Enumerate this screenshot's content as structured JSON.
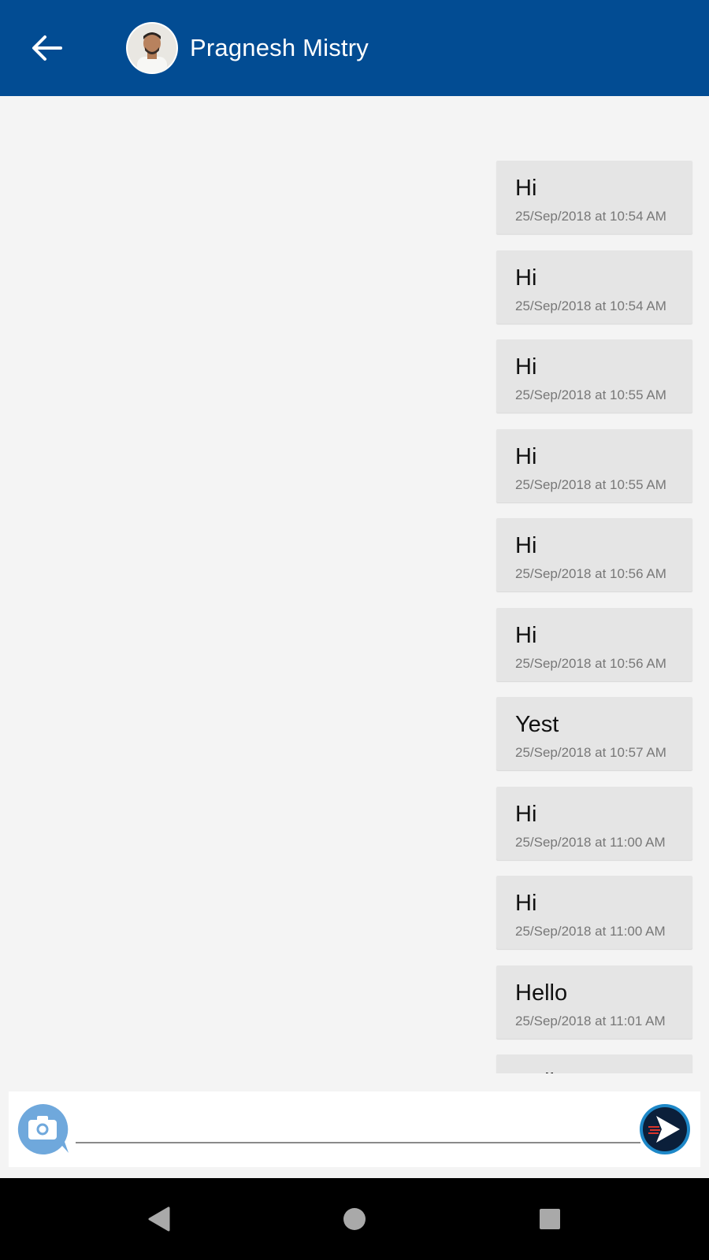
{
  "header": {
    "contact_name": "Pragnesh Mistry",
    "back_icon": "arrow-left-icon",
    "avatar": "contact-avatar"
  },
  "messages": [
    {
      "text": "Hi",
      "time": "25/Sep/2018 at 10:54 AM"
    },
    {
      "text": "Hi",
      "time": "25/Sep/2018 at 10:54 AM"
    },
    {
      "text": "Hi",
      "time": "25/Sep/2018 at 10:55 AM"
    },
    {
      "text": "Hi",
      "time": "25/Sep/2018 at 10:55 AM"
    },
    {
      "text": "Hi",
      "time": "25/Sep/2018 at 10:56 AM"
    },
    {
      "text": "Hi",
      "time": "25/Sep/2018 at 10:56 AM"
    },
    {
      "text": "Yest",
      "time": "25/Sep/2018 at 10:57 AM"
    },
    {
      "text": "Hi",
      "time": "25/Sep/2018 at 11:00 AM"
    },
    {
      "text": "Hi",
      "time": "25/Sep/2018 at 11:00 AM"
    },
    {
      "text": "Hello",
      "time": "25/Sep/2018 at 11:01 AM"
    },
    {
      "text": "Hello",
      "time": ""
    }
  ],
  "composer": {
    "message_value": "",
    "camera_icon": "camera-icon",
    "send_icon": "send-icon"
  },
  "system_nav": {
    "back": "nav-back-icon",
    "home": "nav-home-icon",
    "recents": "nav-recents-icon"
  },
  "colors": {
    "app_bar": "#024c93",
    "bubble": "#e5e5e5",
    "background": "#f4f4f4",
    "camera_accent": "#6fa8dc",
    "send_ring": "#1e88c8"
  }
}
